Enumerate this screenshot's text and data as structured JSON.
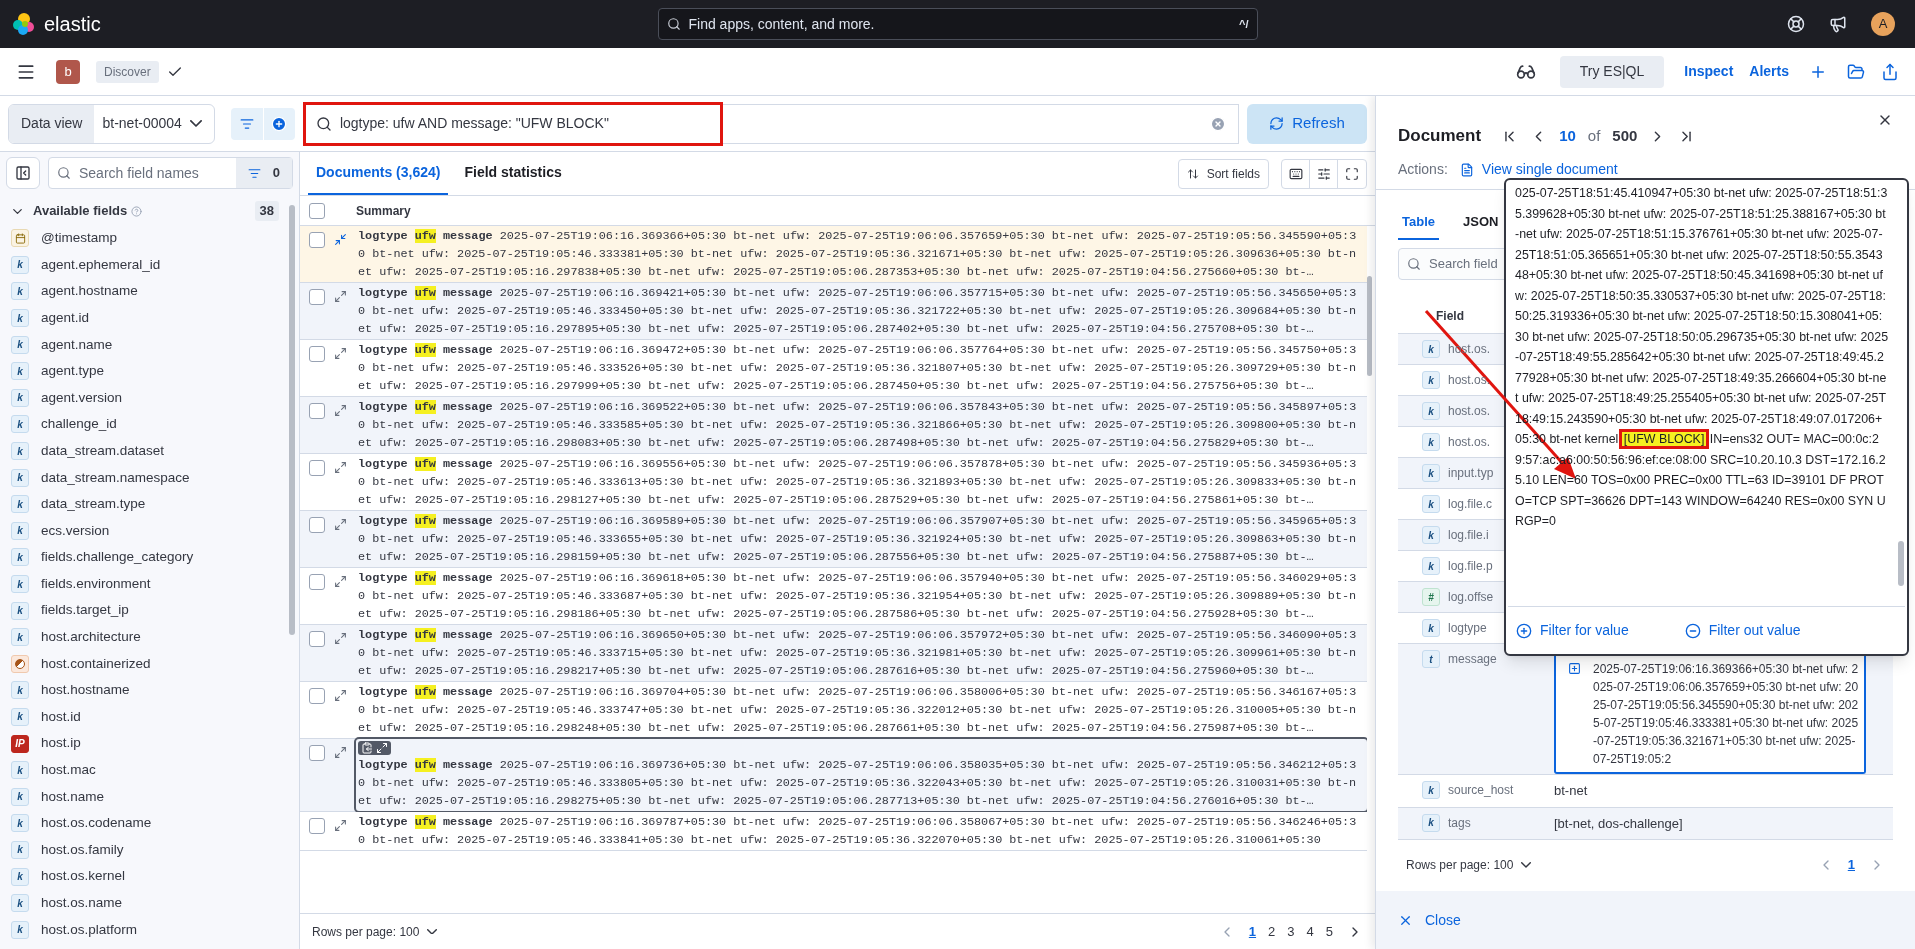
{
  "header": {
    "logo": "elastic",
    "search_placeholder": "Find apps, content, and more.",
    "shortcut": "^/",
    "avatar": "A"
  },
  "breadcrumbs": {
    "space": "b",
    "app": "Discover"
  },
  "top_actions": {
    "try_esql": "Try ES|QL",
    "links": [
      "Inspect",
      "Alerts"
    ]
  },
  "query_bar": {
    "data_view_label": "Data view",
    "data_view": "bt-net-00004",
    "query": "logtype: ufw AND message: \"UFW BLOCK\"",
    "refresh": "Refresh"
  },
  "sidebar": {
    "search_placeholder": "Search field names",
    "filter_count": "0",
    "section": "Available fields",
    "section_count": "38",
    "expanded": true,
    "fields": [
      {
        "kind": "date",
        "name": "@timestamp"
      },
      {
        "kind": "keyword",
        "badge": "k",
        "name": "agent.ephemeral_id"
      },
      {
        "kind": "keyword",
        "badge": "k",
        "name": "agent.hostname"
      },
      {
        "kind": "keyword",
        "badge": "k",
        "name": "agent.id"
      },
      {
        "kind": "keyword",
        "badge": "k",
        "name": "agent.name"
      },
      {
        "kind": "keyword",
        "badge": "k",
        "name": "agent.type"
      },
      {
        "kind": "keyword",
        "badge": "k",
        "name": "agent.version"
      },
      {
        "kind": "keyword",
        "badge": "k",
        "name": "challenge_id"
      },
      {
        "kind": "keyword",
        "badge": "k",
        "name": "data_stream.dataset"
      },
      {
        "kind": "keyword",
        "badge": "k",
        "name": "data_stream.namespace"
      },
      {
        "kind": "keyword",
        "badge": "k",
        "name": "data_stream.type"
      },
      {
        "kind": "keyword",
        "badge": "k",
        "name": "ecs.version"
      },
      {
        "kind": "keyword",
        "badge": "k",
        "name": "fields.challenge_category"
      },
      {
        "kind": "keyword",
        "badge": "k",
        "name": "fields.environment"
      },
      {
        "kind": "keyword",
        "badge": "k",
        "name": "fields.target_ip"
      },
      {
        "kind": "keyword",
        "badge": "k",
        "name": "host.architecture"
      },
      {
        "kind": "boolean",
        "name": "host.containerized"
      },
      {
        "kind": "keyword",
        "badge": "k",
        "name": "host.hostname"
      },
      {
        "kind": "keyword",
        "badge": "k",
        "name": "host.id"
      },
      {
        "kind": "ip",
        "badge": "IP",
        "name": "host.ip"
      },
      {
        "kind": "keyword",
        "badge": "k",
        "name": "host.mac"
      },
      {
        "kind": "keyword",
        "badge": "k",
        "name": "host.name"
      },
      {
        "kind": "keyword",
        "badge": "k",
        "name": "host.os.codename"
      },
      {
        "kind": "keyword",
        "badge": "k",
        "name": "host.os.family"
      },
      {
        "kind": "keyword",
        "badge": "k",
        "name": "host.os.kernel"
      },
      {
        "kind": "keyword",
        "badge": "k",
        "name": "host.os.name"
      },
      {
        "kind": "keyword",
        "badge": "k",
        "name": "host.os.platform"
      }
    ]
  },
  "tabs": [
    {
      "label": "Documents (3,624)",
      "selected": true
    },
    {
      "label": "Field statistics",
      "selected": false
    }
  ],
  "sort_fields": "Sort fields",
  "table": {
    "column": "Summary",
    "select_all_checked": false,
    "rows": [
      {
        "checked": false,
        "selected": true,
        "focused": false,
        "fields": [
          {
            "name": "logtype",
            "value": "ufw",
            "highlighted": true
          },
          {
            "name": "message",
            "value": "2025-07-25T19:06:16.369366+05:30 bt-net ufw: 2025-07-25T19:06:06.357659+05:30 bt-net ufw: 2025-07-25T19:05:56.345590+05:30 bt-net ufw: 2025-07-25T19:05:46.333381+05:30 bt-net ufw: 2025-07-25T19:05:36.321671+05:30 bt-net ufw: 2025-07-25T19:05:26.309636+05:30 bt-net ufw: 2025-07-25T19:05:16.297838+05:30 bt-net ufw: 2025-07-25T19:05:06.287353+05:30 bt-net ufw: 2025-07-25T19:04:56.275660+05:30 bt-…",
            "highlighted": false
          }
        ]
      },
      {
        "checked": false,
        "selected": false,
        "focused": false,
        "fields": [
          {
            "name": "logtype",
            "value": "ufw",
            "highlighted": true
          },
          {
            "name": "message",
            "value": "2025-07-25T19:06:16.369421+05:30 bt-net ufw: 2025-07-25T19:06:06.357715+05:30 bt-net ufw: 2025-07-25T19:05:56.345650+05:30 bt-net ufw: 2025-07-25T19:05:46.333450+05:30 bt-net ufw: 2025-07-25T19:05:36.321722+05:30 bt-net ufw: 2025-07-25T19:05:26.309684+05:30 bt-net ufw: 2025-07-25T19:05:16.297895+05:30 bt-net ufw: 2025-07-25T19:05:06.287402+05:30 bt-net ufw: 2025-07-25T19:04:56.275708+05:30 bt-…",
            "highlighted": false
          }
        ]
      },
      {
        "checked": false,
        "selected": false,
        "focused": false,
        "fields": [
          {
            "name": "logtype",
            "value": "ufw",
            "highlighted": true
          },
          {
            "name": "message",
            "value": "2025-07-25T19:06:16.369472+05:30 bt-net ufw: 2025-07-25T19:06:06.357764+05:30 bt-net ufw: 2025-07-25T19:05:56.345750+05:30 bt-net ufw: 2025-07-25T19:05:46.333526+05:30 bt-net ufw: 2025-07-25T19:05:36.321807+05:30 bt-net ufw: 2025-07-25T19:05:26.309729+05:30 bt-net ufw: 2025-07-25T19:05:16.297999+05:30 bt-net ufw: 2025-07-25T19:05:06.287450+05:30 bt-net ufw: 2025-07-25T19:04:56.275756+05:30 bt-…",
            "highlighted": false
          }
        ]
      },
      {
        "checked": false,
        "selected": false,
        "focused": false,
        "fields": [
          {
            "name": "logtype",
            "value": "ufw",
            "highlighted": true
          },
          {
            "name": "message",
            "value": "2025-07-25T19:06:16.369522+05:30 bt-net ufw: 2025-07-25T19:06:06.357843+05:30 bt-net ufw: 2025-07-25T19:05:56.345897+05:30 bt-net ufw: 2025-07-25T19:05:46.333585+05:30 bt-net ufw: 2025-07-25T19:05:36.321866+05:30 bt-net ufw: 2025-07-25T19:05:26.309800+05:30 bt-net ufw: 2025-07-25T19:05:16.298083+05:30 bt-net ufw: 2025-07-25T19:05:06.287498+05:30 bt-net ufw: 2025-07-25T19:04:56.275829+05:30 bt-…",
            "highlighted": false
          }
        ]
      },
      {
        "checked": false,
        "selected": false,
        "focused": false,
        "fields": [
          {
            "name": "logtype",
            "value": "ufw",
            "highlighted": true
          },
          {
            "name": "message",
            "value": "2025-07-25T19:06:16.369556+05:30 bt-net ufw: 2025-07-25T19:06:06.357878+05:30 bt-net ufw: 2025-07-25T19:05:56.345936+05:30 bt-net ufw: 2025-07-25T19:05:46.333613+05:30 bt-net ufw: 2025-07-25T19:05:36.321893+05:30 bt-net ufw: 2025-07-25T19:05:26.309833+05:30 bt-net ufw: 2025-07-25T19:05:16.298127+05:30 bt-net ufw: 2025-07-25T19:05:06.287529+05:30 bt-net ufw: 2025-07-25T19:04:56.275861+05:30 bt-…",
            "highlighted": false
          }
        ]
      },
      {
        "checked": false,
        "selected": false,
        "focused": false,
        "fields": [
          {
            "name": "logtype",
            "value": "ufw",
            "highlighted": true
          },
          {
            "name": "message",
            "value": "2025-07-25T19:06:16.369589+05:30 bt-net ufw: 2025-07-25T19:06:06.357907+05:30 bt-net ufw: 2025-07-25T19:05:56.345965+05:30 bt-net ufw: 2025-07-25T19:05:46.333655+05:30 bt-net ufw: 2025-07-25T19:05:36.321924+05:30 bt-net ufw: 2025-07-25T19:05:26.309863+05:30 bt-net ufw: 2025-07-25T19:05:16.298159+05:30 bt-net ufw: 2025-07-25T19:05:06.287556+05:30 bt-net ufw: 2025-07-25T19:04:56.275887+05:30 bt-…",
            "highlighted": false
          }
        ]
      },
      {
        "checked": false,
        "selected": false,
        "focused": false,
        "fields": [
          {
            "name": "logtype",
            "value": "ufw",
            "highlighted": true
          },
          {
            "name": "message",
            "value": "2025-07-25T19:06:16.369618+05:30 bt-net ufw: 2025-07-25T19:06:06.357940+05:30 bt-net ufw: 2025-07-25T19:05:56.346029+05:30 bt-net ufw: 2025-07-25T19:05:46.333687+05:30 bt-net ufw: 2025-07-25T19:05:36.321954+05:30 bt-net ufw: 2025-07-25T19:05:26.309889+05:30 bt-net ufw: 2025-07-25T19:05:16.298186+05:30 bt-net ufw: 2025-07-25T19:05:06.287586+05:30 bt-net ufw: 2025-07-25T19:04:56.275928+05:30 bt-…",
            "highlighted": false
          }
        ]
      },
      {
        "checked": false,
        "selected": false,
        "focused": false,
        "fields": [
          {
            "name": "logtype",
            "value": "ufw",
            "highlighted": true
          },
          {
            "name": "message",
            "value": "2025-07-25T19:06:16.369650+05:30 bt-net ufw: 2025-07-25T19:06:06.357972+05:30 bt-net ufw: 2025-07-25T19:05:56.346090+05:30 bt-net ufw: 2025-07-25T19:05:46.333715+05:30 bt-net ufw: 2025-07-25T19:05:36.321981+05:30 bt-net ufw: 2025-07-25T19:05:26.309961+05:30 bt-net ufw: 2025-07-25T19:05:16.298217+05:30 bt-net ufw: 2025-07-25T19:05:06.287616+05:30 bt-net ufw: 2025-07-25T19:04:56.275960+05:30 bt-…",
            "highlighted": false
          }
        ]
      },
      {
        "checked": false,
        "selected": false,
        "focused": false,
        "fields": [
          {
            "name": "logtype",
            "value": "ufw",
            "highlighted": true
          },
          {
            "name": "message",
            "value": "2025-07-25T19:06:16.369704+05:30 bt-net ufw: 2025-07-25T19:06:06.358006+05:30 bt-net ufw: 2025-07-25T19:05:56.346167+05:30 bt-net ufw: 2025-07-25T19:05:46.333747+05:30 bt-net ufw: 2025-07-25T19:05:36.322012+05:30 bt-net ufw: 2025-07-25T19:05:26.310005+05:30 bt-net ufw: 2025-07-25T19:05:16.298248+05:30 bt-net ufw: 2025-07-25T19:05:06.287661+05:30 bt-net ufw: 2025-07-25T19:04:56.275987+05:30 bt-…",
            "highlighted": false
          }
        ]
      },
      {
        "checked": false,
        "selected": false,
        "focused": true,
        "fields": [
          {
            "name": "logtype",
            "value": "ufw",
            "highlighted": true
          },
          {
            "name": "message",
            "value": "2025-07-25T19:06:16.369736+05:30 bt-net ufw: 2025-07-25T19:06:06.358035+05:30 bt-net ufw: 2025-07-25T19:05:56.346212+05:30 bt-net ufw: 2025-07-25T19:05:46.333805+05:30 bt-net ufw: 2025-07-25T19:05:36.322043+05:30 bt-net ufw: 2025-07-25T19:05:26.310031+05:30 bt-net ufw: 2025-07-25T19:05:16.298275+05:30 bt-net ufw: 2025-07-25T19:05:06.287713+05:30 bt-net ufw: 2025-07-25T19:04:56.276016+05:30 bt-…",
            "highlighted": false
          }
        ]
      },
      {
        "checked": false,
        "selected": false,
        "focused": false,
        "fields": [
          {
            "name": "logtype",
            "value": "ufw",
            "highlighted": true
          },
          {
            "name": "message",
            "value": "2025-07-25T19:06:16.369787+05:30 bt-net ufw: 2025-07-25T19:06:06.358067+05:30 bt-net ufw: 2025-07-25T19:05:56.346246+05:30 bt-net ufw: 2025-07-25T19:05:46.333841+05:30 bt-net ufw: 2025-07-25T19:05:36.322070+05:30 bt-net ufw: 2025-07-25T19:05:26.310061+05:30",
            "highlighted": false
          }
        ]
      }
    ]
  },
  "footer": {
    "rows_per_page": "Rows per page: 100",
    "pages": [
      {
        "label": "1",
        "selected": true
      },
      {
        "label": "2",
        "selected": false
      },
      {
        "label": "3",
        "selected": false
      },
      {
        "label": "4",
        "selected": false
      },
      {
        "label": "5",
        "selected": false
      }
    ]
  },
  "flyout": {
    "title": "Document",
    "current": "10",
    "of": "of",
    "total": "500",
    "actions_label": "Actions:",
    "view_single": "View single document",
    "tabs": [
      {
        "label": "Table",
        "selected": true
      },
      {
        "label": "JSON",
        "selected": false
      }
    ],
    "search_placeholder": "Search field",
    "column": "Field",
    "rows": [
      {
        "kind": "keyword",
        "badge": "k",
        "name": "host.os."
      },
      {
        "kind": "keyword",
        "badge": "k",
        "name": "host.os."
      },
      {
        "kind": "keyword",
        "badge": "k",
        "name": "host.os."
      },
      {
        "kind": "keyword",
        "badge": "k",
        "name": "host.os."
      },
      {
        "kind": "keyword",
        "badge": "k",
        "name": "input.typ"
      },
      {
        "kind": "keyword",
        "badge": "k",
        "name": "log.file.c"
      },
      {
        "kind": "keyword",
        "badge": "k",
        "name": "log.file.i"
      },
      {
        "kind": "keyword",
        "badge": "k",
        "name": "log.file.p"
      },
      {
        "kind": "number",
        "badge": "#",
        "name": "log.offse"
      },
      {
        "kind": "keyword",
        "badge": "k",
        "name": "logtype"
      },
      {
        "kind": "text",
        "badge": "t",
        "name": "message",
        "value": "2025-07-25T19:06:16.369366+05:30 bt-net ufw: 2025-07-25T19:06:06.357659+05:30 bt-net ufw: 2025-07-25T19:05:56.345590+05:30 bt-net ufw: 2025-07-25T19:05:46.333381+05:30 bt-net ufw: 2025-07-25T19:05:36.321671+05:30 bt-net ufw: 2025-07-25T19:05:2",
        "expanded": true
      },
      {
        "kind": "keyword",
        "badge": "k",
        "name": "source_host",
        "value": "bt-net",
        "expanded": false
      },
      {
        "kind": "keyword",
        "badge": "k",
        "name": "tags",
        "value": "[bt-net, dos-challenge]",
        "expanded": false
      }
    ],
    "rows_per_page": "Rows per page: 100",
    "pages": [
      {
        "label": "1",
        "selected": true
      }
    ],
    "close": "Close",
    "popover": {
      "before": "025-07-25T18:51:45.410947+05:30 bt-net ufw: 2025-07-25T18:51:35.399628+05:30 bt-net ufw: 2025-07-25T18:51:25.388167+05:30 bt-net ufw: 2025-07-25T18:51:15.376761+05:30 bt-net ufw: 2025-07-25T18:51:05.365651+05:30 bt-net ufw: 2025-07-25T18:50:55.354348+05:30 bt-net ufw: 2025-07-25T18:50:45.341698+05:30 bt-net ufw: 2025-07-25T18:50:35.330537+05:30 bt-net ufw: 2025-07-25T18:50:25.319336+05:30 bt-net ufw: 2025-07-25T18:50:15.308041+05:30 bt-net ufw: 2025-07-25T18:50:05.296735+05:30 bt-net ufw: 2025-07-25T18:49:55.285642+05:30 bt-net ufw: 2025-07-25T18:49:45.277928+05:30 bt-net ufw: 2025-07-25T18:49:35.266604+05:30 bt-net ufw: 2025-07-25T18:49:25.255405+05:30 bt-net ufw: 2025-07-25T18:49:15.243590+05:30 bt-net ufw: 2025-07-25T18:49:07.017206+05:30 bt-net kernel ",
      "highlight": "[UFW BLOCK]",
      "after": " IN=ens32 OUT= MAC=00:0c:29:57:ac:a6:00:50:56:96:ef:ce:08:00 SRC=10.20.10.3 DST=172.16.25.10 LEN=60 TOS=0x00 PREC=0x00 TTL=63 ID=39101 DF PROTO=TCP SPT=36626 DPT=143 WINDOW=64240 RES=0x00 SYN URGP=0",
      "filter_for": "Filter for value",
      "filter_out": "Filter out value"
    }
  }
}
